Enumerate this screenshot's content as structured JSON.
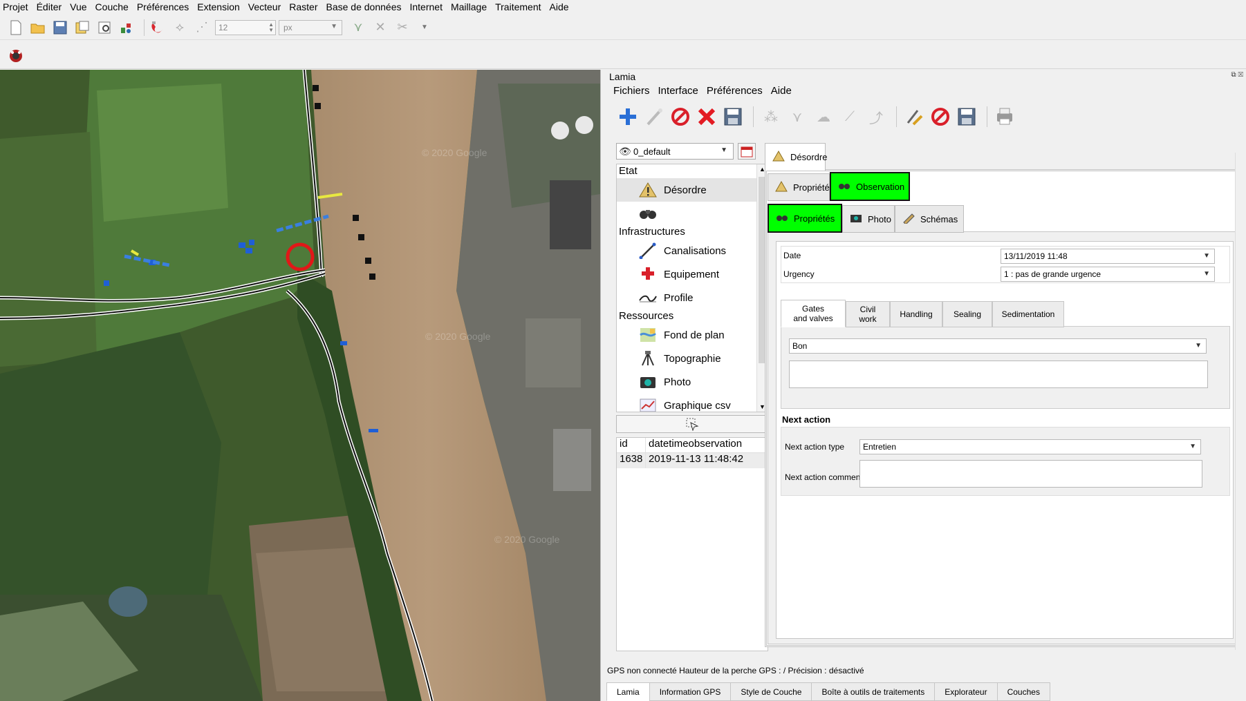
{
  "menubar": {
    "items": [
      "Projet",
      "Éditer",
      "Vue",
      "Couche",
      "Préférences",
      "Extension",
      "Vecteur",
      "Raster",
      "Base de données",
      "Internet",
      "Maillage",
      "Traitement",
      "Aide"
    ]
  },
  "toolbar": {
    "size_value": "12",
    "unit_value": "px"
  },
  "map": {
    "watermarks": [
      "© 2020 Google",
      "© 2020 Google",
      "© 2020 Google"
    ]
  },
  "panel": {
    "title": "Lamia",
    "menu": [
      "Fichiers",
      "Interface",
      "Préférences",
      "Aide"
    ],
    "layer_combo_value": "0_default",
    "tree": {
      "groups": [
        {
          "header": "Etat",
          "items": [
            {
              "label": "Désordre",
              "icon": "warning-icon",
              "selected": true
            },
            {
              "label": "",
              "icon": "binoculars-icon",
              "selected": false
            }
          ]
        },
        {
          "header": "Infrastructures",
          "items": [
            {
              "label": "Canalisations",
              "icon": "pipe-icon",
              "selected": false
            },
            {
              "label": "Equipement",
              "icon": "plus-icon",
              "selected": false
            },
            {
              "label": "Profile",
              "icon": "profile-icon",
              "selected": false
            }
          ]
        },
        {
          "header": "Ressources",
          "items": [
            {
              "label": "Fond de plan",
              "icon": "map-icon",
              "selected": false
            },
            {
              "label": "Topographie",
              "icon": "survey-icon",
              "selected": false
            },
            {
              "label": "Photo",
              "icon": "camera-icon",
              "selected": false
            },
            {
              "label": "Graphique csv",
              "icon": "chart-icon",
              "selected": false
            }
          ]
        }
      ]
    },
    "table": {
      "headers": [
        "id",
        "datetimeobservation"
      ],
      "rows": [
        [
          "1638",
          "2019-11-13 11:48:42"
        ]
      ]
    },
    "form": {
      "main_tab": "Désordre",
      "level1_tabs": [
        "Propriétés",
        "Observation"
      ],
      "level2_tabs": [
        "Propriétés",
        "Photo",
        "Schémas"
      ],
      "date_label": "Date",
      "date_value": "13/11/2019 11:48",
      "urgency_label": "Urgency",
      "urgency_value": "1 : pas de grande urgence",
      "subtabs": [
        "Gates\nand valves",
        "Civil\nwork",
        "Handling",
        "Sealing",
        "Sedimentation"
      ],
      "state_value": "Bon",
      "next_action_title": "Next action",
      "next_action_type_label": "Next action type",
      "next_action_type_value": "Entretien",
      "next_action_comment_label": "Next action comment"
    },
    "status": "GPS non connecté Hauteur de la perche GPS : / Précision : désactivé",
    "bottom_tabs": [
      "Lamia",
      "Information GPS",
      "Style de Couche",
      "Boîte à outils de traitements",
      "Explorateur",
      "Couches"
    ]
  }
}
